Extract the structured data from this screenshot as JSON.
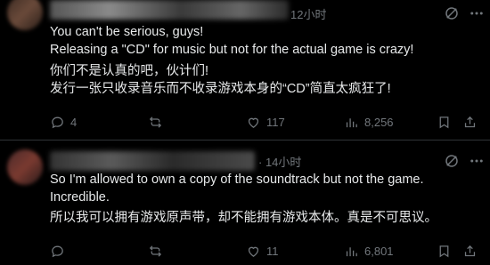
{
  "posts": [
    {
      "time": "12小时",
      "paragraphs": [
        [
          "You can't be serious, guys!",
          "Releasing a \"CD\" for music but not for the actual game is crazy!"
        ],
        [
          "你们不是认真的吧，伙计们!",
          "发行一张只收录音乐而不收录游戏本身的“CD”简直太疯狂了!"
        ]
      ],
      "replies": "4",
      "reposts": "",
      "likes": "117",
      "views": "8,256"
    },
    {
      "time": "· 14小时",
      "paragraphs": [
        [
          "So I'm allowed to own a copy of the soundtrack but not the game.",
          "Incredible."
        ],
        [
          "所以我可以拥有游戏原声带，却不能拥有游戏本体。真是不可思议。"
        ]
      ],
      "replies": "",
      "reposts": "",
      "likes": "11",
      "views": "6,801"
    }
  ],
  "icons": {
    "reply": "reply-icon",
    "repost": "repost-icon",
    "like": "heart-icon",
    "views": "views-icon",
    "bookmark": "bookmark-icon",
    "share": "share-icon",
    "grok": "grok-icon",
    "more": "more-icon"
  },
  "colors": {
    "background": "#000000",
    "text": "#e7e9ea",
    "muted": "#71767b",
    "divider": "#2f3336"
  }
}
